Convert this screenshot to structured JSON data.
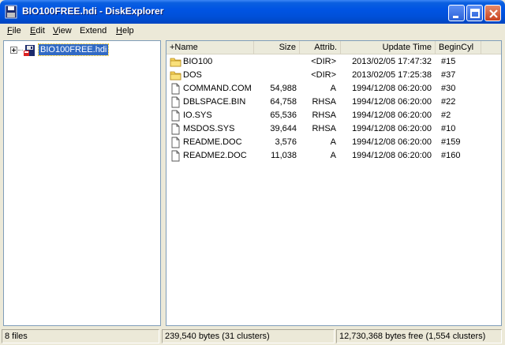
{
  "window": {
    "title": "BIO100FREE.hdi - DiskExplorer"
  },
  "menu": [
    {
      "label_u": "F",
      "label_rest": "ile"
    },
    {
      "label_u": "E",
      "label_rest": "dit"
    },
    {
      "label_u": "V",
      "label_rest": "iew"
    },
    {
      "label_u": "",
      "label_rest": "Extend"
    },
    {
      "label_u": "H",
      "label_rest": "elp"
    }
  ],
  "tree": {
    "root_label": "BIO100FREE.hdi",
    "root_icon": "disk-icon"
  },
  "columns": {
    "name": "+Name",
    "size": "Size",
    "attrib": "Attrib.",
    "update_time": "Update Time",
    "begin_cyl": "BeginCyl"
  },
  "files": [
    {
      "name": "BIO100",
      "size": "",
      "attrib": "<DIR>",
      "time": "2013/02/05 17:47:32",
      "cyl": "#15",
      "icon": "folder-icon"
    },
    {
      "name": "DOS",
      "size": "",
      "attrib": "<DIR>",
      "time": "2013/02/05 17:25:38",
      "cyl": "#37",
      "icon": "folder-icon"
    },
    {
      "name": "COMMAND.COM",
      "size": "54,988",
      "attrib": "A",
      "time": "1994/12/08 06:20:00",
      "cyl": "#30",
      "icon": "file-icon"
    },
    {
      "name": "DBLSPACE.BIN",
      "size": "64,758",
      "attrib": "RHSA",
      "time": "1994/12/08 06:20:00",
      "cyl": "#22",
      "icon": "file-icon"
    },
    {
      "name": "IO.SYS",
      "size": "65,536",
      "attrib": "RHSA",
      "time": "1994/12/08 06:20:00",
      "cyl": "#2",
      "icon": "file-icon"
    },
    {
      "name": "MSDOS.SYS",
      "size": "39,644",
      "attrib": "RHSA",
      "time": "1994/12/08 06:20:00",
      "cyl": "#10",
      "icon": "file-icon"
    },
    {
      "name": "README.DOC",
      "size": "3,576",
      "attrib": "A",
      "time": "1994/12/08 06:20:00",
      "cyl": "#159",
      "icon": "file-icon"
    },
    {
      "name": "README2.DOC",
      "size": "11,038",
      "attrib": "A",
      "time": "1994/12/08 06:20:00",
      "cyl": "#160",
      "icon": "file-icon"
    }
  ],
  "status": {
    "file_count": "8 files",
    "used": "239,540 bytes (31 clusters)",
    "free": "12,730,368 bytes free (1,554 clusters)"
  },
  "colors": {
    "titlebar": "#0054e3",
    "selection": "#316ac5",
    "folder": "#f6d25a"
  }
}
